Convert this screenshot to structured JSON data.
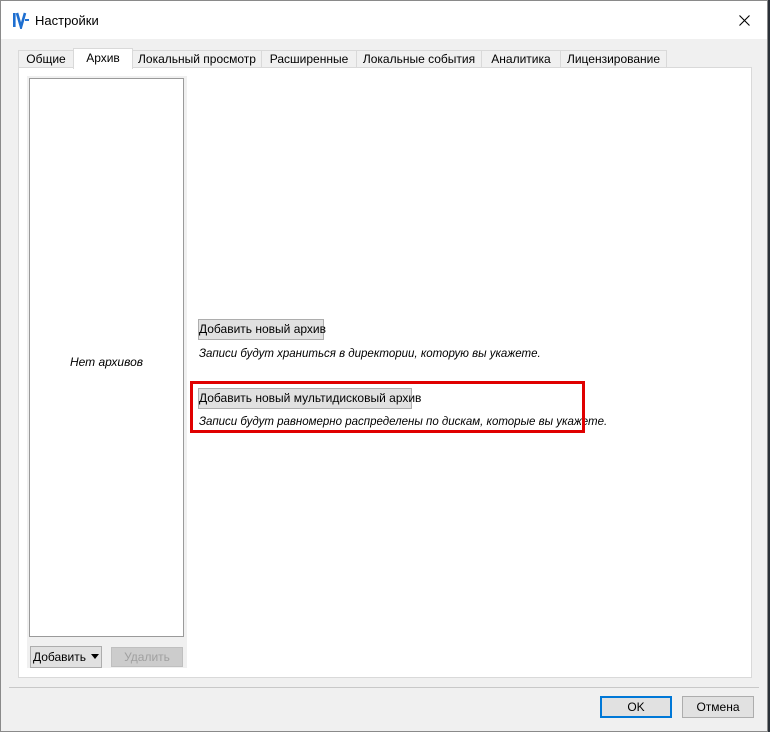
{
  "window": {
    "title": "Настройки"
  },
  "tabs": [
    {
      "label": "Общие"
    },
    {
      "label": "Архив"
    },
    {
      "label": "Локальный просмотр"
    },
    {
      "label": "Расширенные"
    },
    {
      "label": "Локальные события"
    },
    {
      "label": "Аналитика"
    },
    {
      "label": "Лицензирование"
    }
  ],
  "archive": {
    "empty_text": "Нет архивов",
    "add_label": "Добавить",
    "delete_label": "Удалить",
    "add_archive_label": "Добавить новый архив",
    "add_archive_hint": "Записи будут храниться в директории, которую вы укажете.",
    "add_multidisk_label": "Добавить новый мультидисковый архив",
    "add_multidisk_hint": "Записи будут равномерно распределены по дискам, которые вы укажете."
  },
  "footer": {
    "ok_label": "OK",
    "cancel_label": "Отмена"
  },
  "colors": {
    "highlight": "#e00000",
    "focus": "#0078d7",
    "app_icon": "#1e6fd0"
  }
}
